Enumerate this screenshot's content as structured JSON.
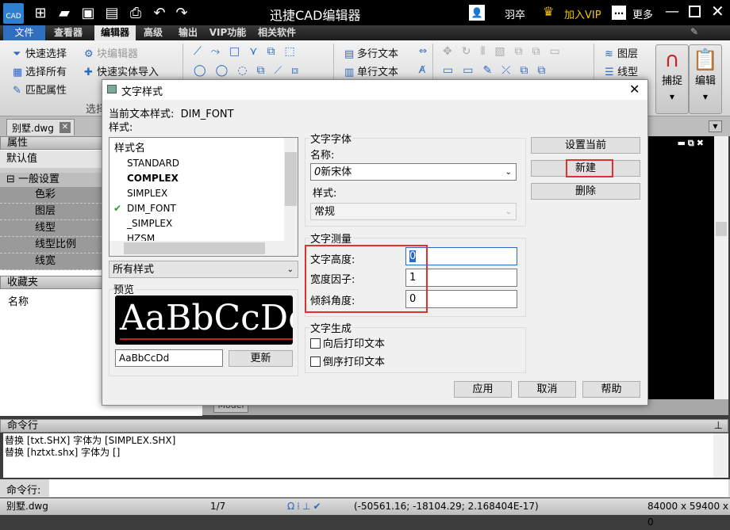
{
  "app": {
    "title": "迅捷CAD编辑器",
    "logo": "CAD",
    "user": "羽卒",
    "vip": "加入VIP",
    "more": "更多"
  },
  "menu": {
    "tabs": [
      "文件",
      "查看器",
      "编辑器",
      "高级",
      "输出",
      "VIP功能",
      "相关软件"
    ],
    "active": "编辑器"
  },
  "ribbon": {
    "quick_select": "快速选择",
    "block_editor": "块编辑器",
    "select_all": "选择所有",
    "quick_import": "快速实体导入",
    "match_props": "匹配属性",
    "group_select": "选择",
    "mtext": "多行文本",
    "stext": "单行文本",
    "layers": "图层",
    "linetype": "线型",
    "snap": "捕捉",
    "edit": "编辑"
  },
  "doc_tab": {
    "name": "别墅.dwg"
  },
  "left_panel": {
    "header": "属性",
    "default": "默认值",
    "section": "一般设置",
    "items": [
      "色彩",
      "图层",
      "线型",
      "线型比例",
      "线宽"
    ],
    "favorites": "收藏夹",
    "name_label": "名称"
  },
  "model_tab": "Model",
  "dialog": {
    "title": "文字样式",
    "current_label": "当前文本样式:",
    "current_value": "DIM_FONT",
    "styles_label": "样式:",
    "list_header": "样式名",
    "styles": [
      "STANDARD",
      "COMPLEX",
      "SIMPLEX",
      "DIM_FONT",
      "_SIMPLEX",
      "HZSM"
    ],
    "checked_style": "DIM_FONT",
    "bold_style": "COMPLEX",
    "filter": "所有样式",
    "preview_label": "预览",
    "preview_text": "AaBbCcDd",
    "preview_input": "AaBbCcDd",
    "update": "更新",
    "font_group": "文字字体",
    "name_label": "名称:",
    "font_name": "新宋体",
    "style_label": "样式:",
    "font_style": "常规",
    "measure_group": "文字测量",
    "height_label": "文字高度:",
    "height": "0",
    "width_label": "宽度因子:",
    "width": "1",
    "oblique_label": "倾斜角度:",
    "oblique": "0",
    "gen_group": "文字生成",
    "backward": "向后打印文本",
    "upside": "倒序打印文本",
    "set_current": "设置当前",
    "new": "新建",
    "delete": "删除",
    "apply": "应用",
    "cancel": "取消",
    "help": "帮助",
    "highlight_color": "#e03030"
  },
  "command": {
    "header": "命令行",
    "lines": [
      "替换 [txt.SHX] 字体为 [SIMPLEX.SHX]",
      "替换 [hztxt.shx] 字体为 []"
    ],
    "input_label": "命令行:"
  },
  "status": {
    "file": "别墅.dwg",
    "page": "1/7",
    "coords": "(-50561.16; -18104.29; 2.168404E-17)",
    "size": "84000 x 59400 x 0"
  }
}
